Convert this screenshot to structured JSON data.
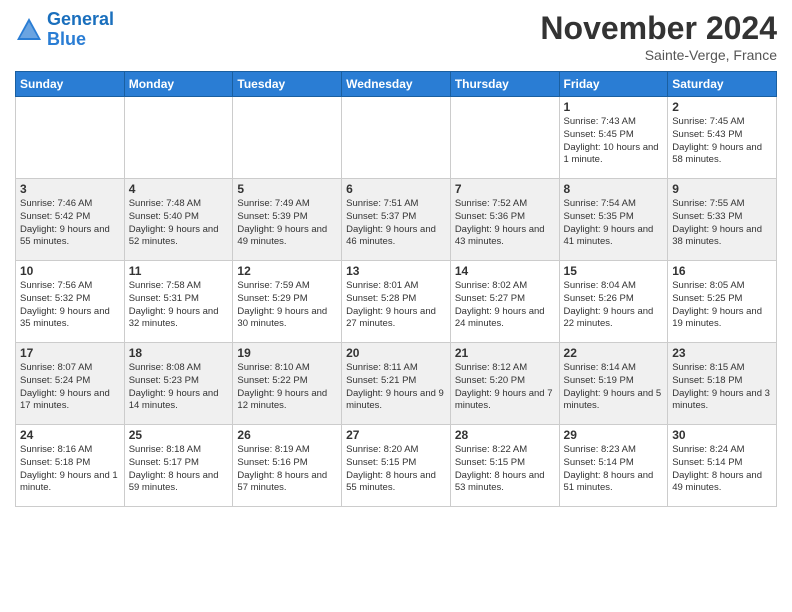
{
  "logo": {
    "line1": "General",
    "line2": "Blue"
  },
  "title": "November 2024",
  "subtitle": "Sainte-Verge, France",
  "days_of_week": [
    "Sunday",
    "Monday",
    "Tuesday",
    "Wednesday",
    "Thursday",
    "Friday",
    "Saturday"
  ],
  "weeks": [
    [
      {
        "day": "",
        "info": ""
      },
      {
        "day": "",
        "info": ""
      },
      {
        "day": "",
        "info": ""
      },
      {
        "day": "",
        "info": ""
      },
      {
        "day": "",
        "info": ""
      },
      {
        "day": "1",
        "info": "Sunrise: 7:43 AM\nSunset: 5:45 PM\nDaylight: 10 hours and 1 minute."
      },
      {
        "day": "2",
        "info": "Sunrise: 7:45 AM\nSunset: 5:43 PM\nDaylight: 9 hours and 58 minutes."
      }
    ],
    [
      {
        "day": "3",
        "info": "Sunrise: 7:46 AM\nSunset: 5:42 PM\nDaylight: 9 hours and 55 minutes."
      },
      {
        "day": "4",
        "info": "Sunrise: 7:48 AM\nSunset: 5:40 PM\nDaylight: 9 hours and 52 minutes."
      },
      {
        "day": "5",
        "info": "Sunrise: 7:49 AM\nSunset: 5:39 PM\nDaylight: 9 hours and 49 minutes."
      },
      {
        "day": "6",
        "info": "Sunrise: 7:51 AM\nSunset: 5:37 PM\nDaylight: 9 hours and 46 minutes."
      },
      {
        "day": "7",
        "info": "Sunrise: 7:52 AM\nSunset: 5:36 PM\nDaylight: 9 hours and 43 minutes."
      },
      {
        "day": "8",
        "info": "Sunrise: 7:54 AM\nSunset: 5:35 PM\nDaylight: 9 hours and 41 minutes."
      },
      {
        "day": "9",
        "info": "Sunrise: 7:55 AM\nSunset: 5:33 PM\nDaylight: 9 hours and 38 minutes."
      }
    ],
    [
      {
        "day": "10",
        "info": "Sunrise: 7:56 AM\nSunset: 5:32 PM\nDaylight: 9 hours and 35 minutes."
      },
      {
        "day": "11",
        "info": "Sunrise: 7:58 AM\nSunset: 5:31 PM\nDaylight: 9 hours and 32 minutes."
      },
      {
        "day": "12",
        "info": "Sunrise: 7:59 AM\nSunset: 5:29 PM\nDaylight: 9 hours and 30 minutes."
      },
      {
        "day": "13",
        "info": "Sunrise: 8:01 AM\nSunset: 5:28 PM\nDaylight: 9 hours and 27 minutes."
      },
      {
        "day": "14",
        "info": "Sunrise: 8:02 AM\nSunset: 5:27 PM\nDaylight: 9 hours and 24 minutes."
      },
      {
        "day": "15",
        "info": "Sunrise: 8:04 AM\nSunset: 5:26 PM\nDaylight: 9 hours and 22 minutes."
      },
      {
        "day": "16",
        "info": "Sunrise: 8:05 AM\nSunset: 5:25 PM\nDaylight: 9 hours and 19 minutes."
      }
    ],
    [
      {
        "day": "17",
        "info": "Sunrise: 8:07 AM\nSunset: 5:24 PM\nDaylight: 9 hours and 17 minutes."
      },
      {
        "day": "18",
        "info": "Sunrise: 8:08 AM\nSunset: 5:23 PM\nDaylight: 9 hours and 14 minutes."
      },
      {
        "day": "19",
        "info": "Sunrise: 8:10 AM\nSunset: 5:22 PM\nDaylight: 9 hours and 12 minutes."
      },
      {
        "day": "20",
        "info": "Sunrise: 8:11 AM\nSunset: 5:21 PM\nDaylight: 9 hours and 9 minutes."
      },
      {
        "day": "21",
        "info": "Sunrise: 8:12 AM\nSunset: 5:20 PM\nDaylight: 9 hours and 7 minutes."
      },
      {
        "day": "22",
        "info": "Sunrise: 8:14 AM\nSunset: 5:19 PM\nDaylight: 9 hours and 5 minutes."
      },
      {
        "day": "23",
        "info": "Sunrise: 8:15 AM\nSunset: 5:18 PM\nDaylight: 9 hours and 3 minutes."
      }
    ],
    [
      {
        "day": "24",
        "info": "Sunrise: 8:16 AM\nSunset: 5:18 PM\nDaylight: 9 hours and 1 minute."
      },
      {
        "day": "25",
        "info": "Sunrise: 8:18 AM\nSunset: 5:17 PM\nDaylight: 8 hours and 59 minutes."
      },
      {
        "day": "26",
        "info": "Sunrise: 8:19 AM\nSunset: 5:16 PM\nDaylight: 8 hours and 57 minutes."
      },
      {
        "day": "27",
        "info": "Sunrise: 8:20 AM\nSunset: 5:15 PM\nDaylight: 8 hours and 55 minutes."
      },
      {
        "day": "28",
        "info": "Sunrise: 8:22 AM\nSunset: 5:15 PM\nDaylight: 8 hours and 53 minutes."
      },
      {
        "day": "29",
        "info": "Sunrise: 8:23 AM\nSunset: 5:14 PM\nDaylight: 8 hours and 51 minutes."
      },
      {
        "day": "30",
        "info": "Sunrise: 8:24 AM\nSunset: 5:14 PM\nDaylight: 8 hours and 49 minutes."
      }
    ]
  ]
}
